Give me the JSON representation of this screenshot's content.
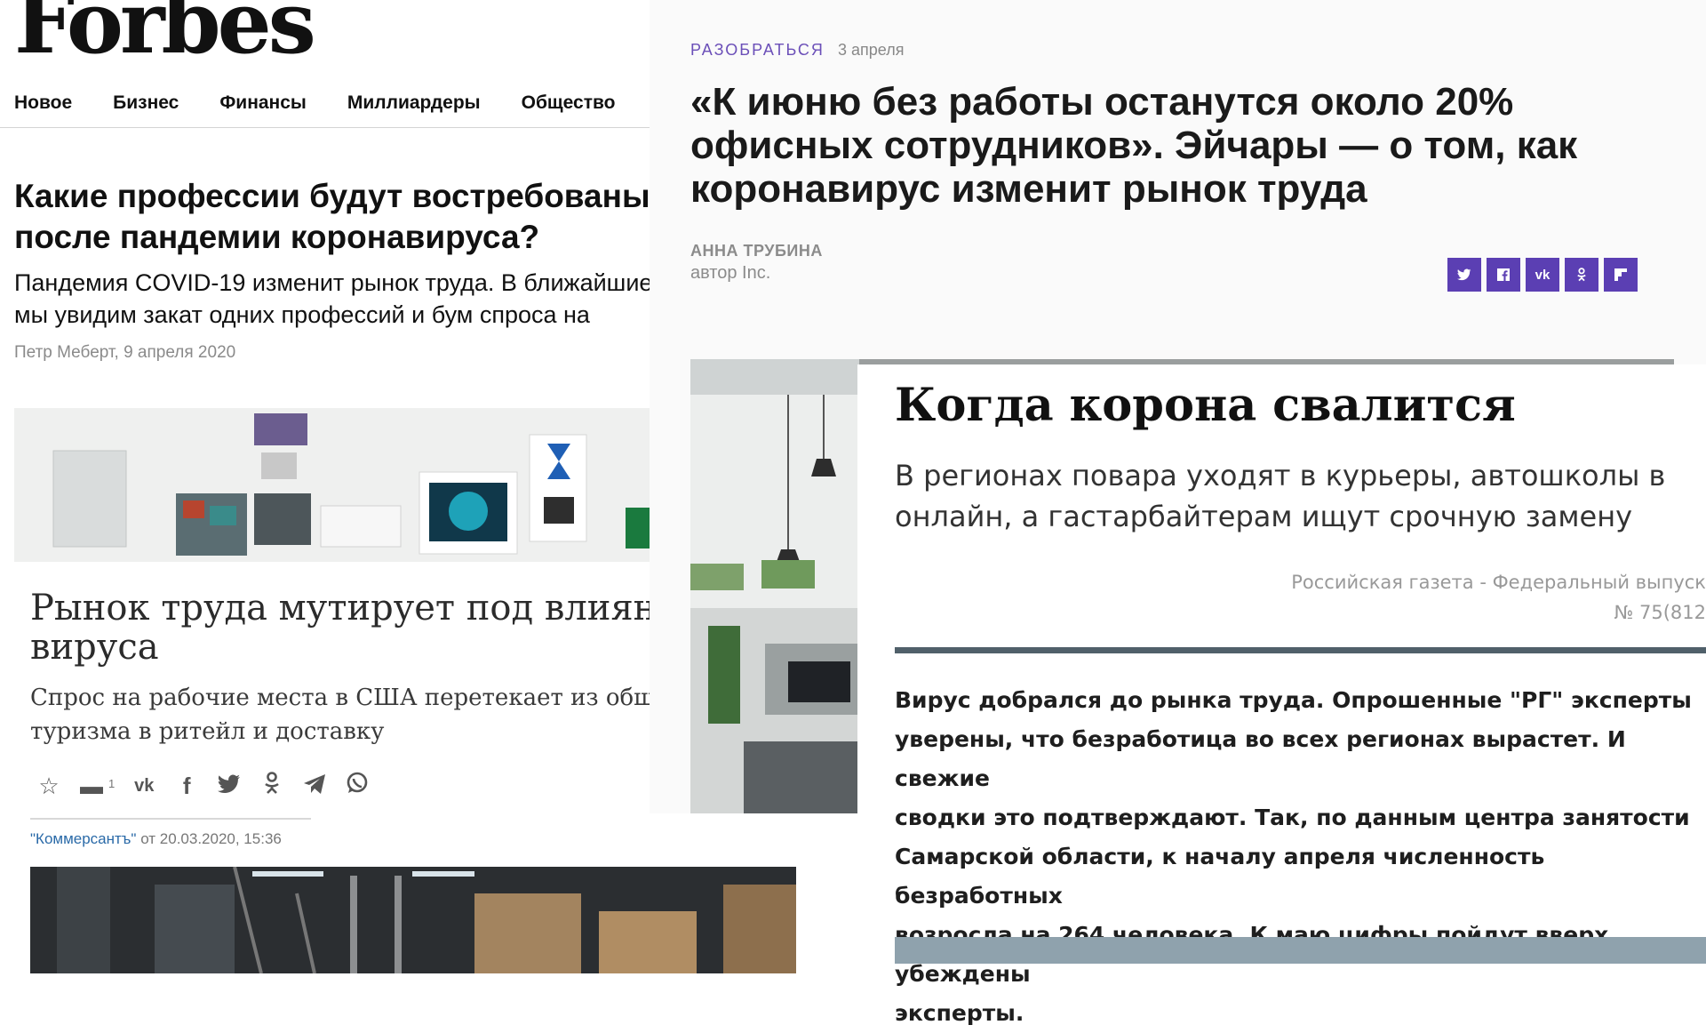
{
  "forbes": {
    "logo": "Forbes",
    "nav": [
      "Новое",
      "Бизнес",
      "Финансы",
      "Миллиардеры",
      "Общество"
    ],
    "headline_lines": [
      "Какие профессии будут востребованы",
      "после пандемии коронавируса?"
    ],
    "lead_lines": [
      "Пандемия COVID-19 изменит рынок труда. В ближайшие",
      "мы увидим закат одних профессий и бум спроса на"
    ],
    "byline": "Петр Меберт, 9 апреля 2020"
  },
  "kommersant": {
    "headline_lines": [
      "Рынок труда мутирует под влиянием",
      "вируса"
    ],
    "subtitle_lines": [
      "Спрос на рабочие места в США перетекает из общепита и",
      "туризма в ритейл и доставку"
    ],
    "comment_count": "1",
    "share_icons": [
      "favorite-icon",
      "comment-icon",
      "vk-icon",
      "facebook-icon",
      "twitter-icon",
      "odnoklassniki-icon",
      "telegram-icon",
      "whatsapp-icon"
    ],
    "source_name": "\"Коммерсантъ\"",
    "source_date": " от 20.03.2020, 15:36"
  },
  "inc": {
    "kicker": "РАЗОБРАТЬСЯ",
    "date": "3 апреля",
    "headline_lines": [
      "«К июню без работы останутся около 20%",
      "офисных сотрудников». Эйчары — о том, как",
      "коронавирус изменит рынок труда"
    ],
    "author": "АННА ТРУБИНА",
    "author_role": "автор Inc.",
    "accent_color": "#5b3fb3"
  },
  "rg": {
    "title": "Когда корона свалится",
    "lead_lines": [
      "В регионах повара уходят в курьеры, автошколы в",
      "онлайн, а гастарбайтерам ищут срочную замену"
    ],
    "publication_lines": [
      "Российская газета - Федеральный выпуск",
      "№ 75(812"
    ],
    "body_lines": [
      "Вирус добрался до рынка труда. Опрошенные \"РГ\" эксперты",
      "уверены, что безработица во всех регионах вырастет. И свежие",
      "сводки это подтверждают. Так, по данным центра занятости",
      "Самарской области, к началу апреля численность безработных",
      "возросла на 264 человека. К маю цифры пойдут вверх, убеждены",
      "эксперты."
    ]
  }
}
